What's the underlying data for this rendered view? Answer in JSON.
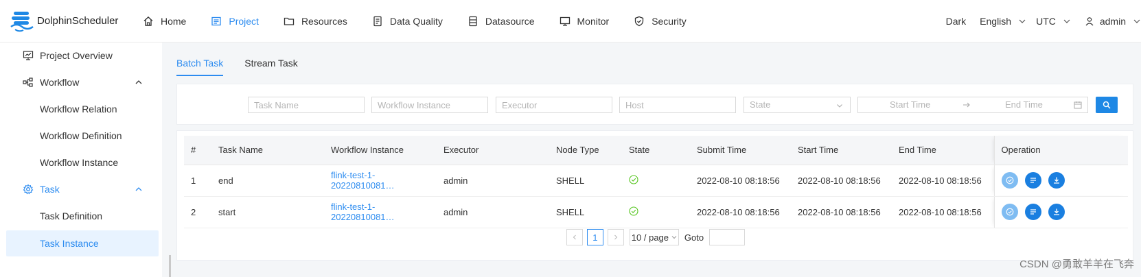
{
  "app": {
    "name": "DolphinScheduler",
    "brand_color": "#2d8cf0"
  },
  "nav": [
    {
      "label": "Home",
      "icon": "home-icon"
    },
    {
      "label": "Project",
      "icon": "project-icon",
      "active": true
    },
    {
      "label": "Resources",
      "icon": "folder-icon"
    },
    {
      "label": "Data Quality",
      "icon": "data-quality-icon"
    },
    {
      "label": "Datasource",
      "icon": "datasource-icon"
    },
    {
      "label": "Monitor",
      "icon": "monitor-icon"
    },
    {
      "label": "Security",
      "icon": "shield-icon"
    }
  ],
  "header_tools": {
    "theme": "Dark",
    "language": "English",
    "timezone": "UTC",
    "user": "admin"
  },
  "sidebar": {
    "items": [
      {
        "label": "Project Overview",
        "icon": "overview-icon"
      },
      {
        "label": "Workflow",
        "icon": "workflow-icon",
        "expanded": true
      },
      {
        "label": "Workflow Relation"
      },
      {
        "label": "Workflow Definition"
      },
      {
        "label": "Workflow Instance"
      },
      {
        "label": "Task",
        "icon": "gear-icon",
        "expanded": true
      },
      {
        "label": "Task Definition"
      },
      {
        "label": "Task Instance",
        "selected": true
      }
    ]
  },
  "tabs": [
    {
      "label": "Batch Task",
      "active": true
    },
    {
      "label": "Stream Task"
    }
  ],
  "filters": {
    "task_name": "Task Name",
    "workflow_instance": "Workflow Instance",
    "executor": "Executor",
    "host": "Host",
    "state": "State",
    "start_time": "Start Time",
    "end_time": "End Time"
  },
  "table": {
    "headers": [
      "#",
      "Task Name",
      "Workflow Instance",
      "Executor",
      "Node Type",
      "State",
      "Submit Time",
      "Start Time",
      "End Time",
      "Operation"
    ],
    "rows": [
      {
        "num": "1",
        "task_name": "end",
        "workflow_instance": "flink-test-1-20220810081…",
        "executor": "admin",
        "node_type": "SHELL",
        "state": "success-icon",
        "submit_time": "2022-08-10 08:18:56",
        "start_time": "2022-08-10 08:18:56",
        "end_time": "2022-08-10 08:18:56"
      },
      {
        "num": "2",
        "task_name": "start",
        "workflow_instance": "flink-test-1-20220810081…",
        "executor": "admin",
        "node_type": "SHELL",
        "state": "success-icon",
        "submit_time": "2022-08-10 08:18:56",
        "start_time": "2022-08-10 08:18:56",
        "end_time": "2022-08-10 08:18:56"
      }
    ]
  },
  "pagination": {
    "current_page": "1",
    "page_size": "10 / page",
    "goto_label": "Goto"
  },
  "watermark": "CSDN @勇敢羊羊在飞奔"
}
